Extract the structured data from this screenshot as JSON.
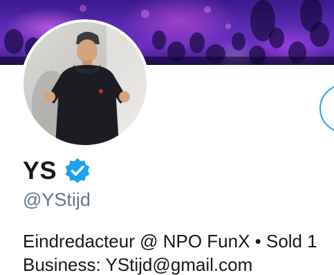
{
  "profile": {
    "display_name": "YS",
    "handle": "@YStijd",
    "bio_line_1": "Eindredacteur @ NPO FunX • Sold 1",
    "bio_line_2": "Business: YStijd@gmail.com",
    "verified_badge": "verified-checkmark-icon"
  },
  "colors": {
    "accent": "#1da1f2",
    "text_primary": "#14171a",
    "text_secondary": "#657786",
    "banner": "#5a2ab0"
  }
}
